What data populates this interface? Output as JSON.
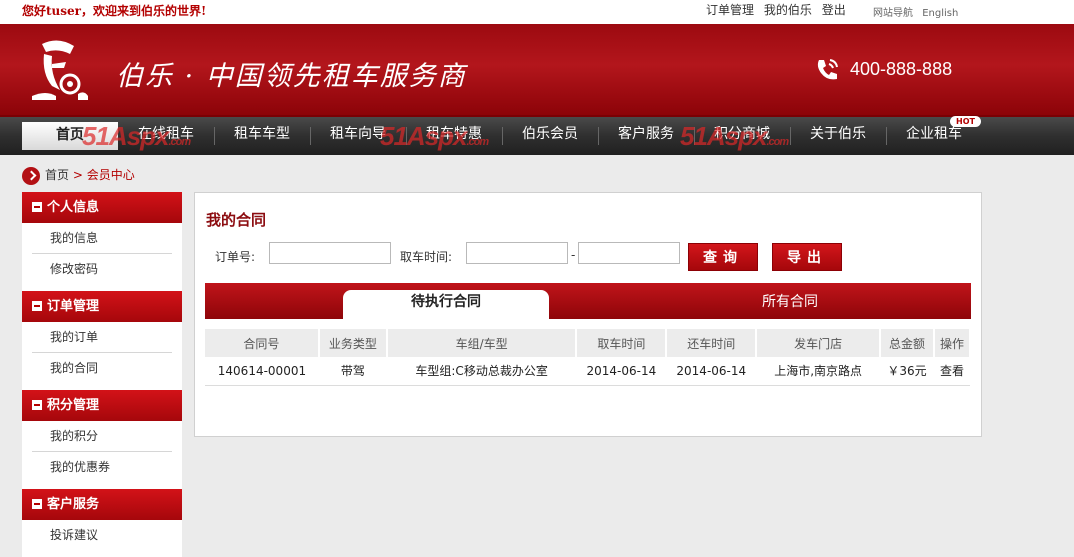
{
  "topbar": {
    "greeting": "您好tuser，欢迎来到伯乐的世界!",
    "links": [
      "订单管理",
      "我的伯乐",
      "登出"
    ],
    "small_links": [
      "网站导航",
      "English"
    ]
  },
  "header": {
    "slogan": "伯乐 · 中国领先租车服务商",
    "phone": "400-888-888"
  },
  "nav": {
    "items": [
      "首页",
      "在线租车",
      "租车车型",
      "租车向导",
      "租车特惠",
      "伯乐会员",
      "客户服务",
      "积分商城",
      "关于伯乐",
      "企业租车"
    ],
    "hot_badge": "HOT",
    "watermark_main": "51Aspx",
    "watermark_sub": ".com"
  },
  "breadcrumb": {
    "home": "首页",
    "current": "> 会员中心"
  },
  "sidebar": {
    "sections": [
      {
        "title": "个人信息",
        "items": [
          "我的信息",
          "修改密码"
        ]
      },
      {
        "title": "订单管理",
        "items": [
          "我的订单",
          "我的合同"
        ]
      },
      {
        "title": "积分管理",
        "items": [
          "我的积分",
          "我的优惠券"
        ]
      },
      {
        "title": "客户服务",
        "items": [
          "投诉建议"
        ]
      }
    ]
  },
  "main": {
    "title": "我的合同",
    "order_no_label": "订单号:",
    "pickup_time_label": "取车时间:",
    "range_separator": "-",
    "order_no_value": "",
    "date_from_value": "",
    "date_to_value": "",
    "search_button": "查询",
    "export_button": "导出",
    "tabs": [
      "待执行合同",
      "所有合同"
    ],
    "table": {
      "headers": [
        "合同号",
        "业务类型",
        "车组/车型",
        "取车时间",
        "还车时间",
        "发车门店",
        "总金额",
        "操作"
      ],
      "rows": [
        [
          "140614-00001",
          "带驾",
          "车型组:C移动总裁办公室",
          "2014-06-14",
          "2014-06-14",
          "上海市,南京路点",
          "￥36元",
          "查看"
        ]
      ]
    }
  },
  "colors": {
    "brand_red": "#b30000",
    "nav_dark": "#2f2f2f"
  }
}
